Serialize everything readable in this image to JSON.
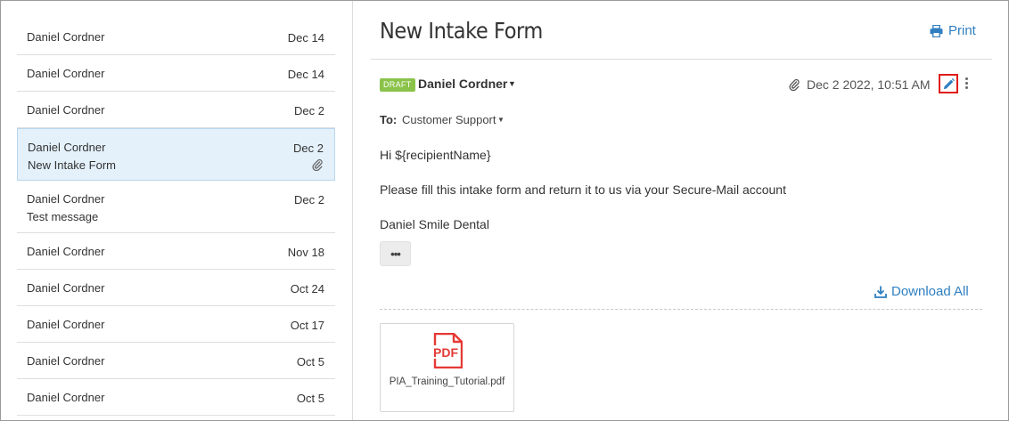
{
  "messages": [
    {
      "sender": "Daniel Cordner",
      "date": "Dec 14",
      "subject": ""
    },
    {
      "sender": "Daniel Cordner",
      "date": "Dec 14",
      "subject": ""
    },
    {
      "sender": "Daniel Cordner",
      "date": "Dec 2",
      "subject": ""
    },
    {
      "sender": "Daniel Cordner",
      "date": "Dec 2",
      "subject": "New Intake Form",
      "has_attachment": true,
      "selected": true
    },
    {
      "sender": "Daniel Cordner",
      "date": "Dec 2",
      "subject": "Test message"
    },
    {
      "sender": "Daniel Cordner",
      "date": "Nov 18",
      "subject": ""
    },
    {
      "sender": "Daniel Cordner",
      "date": "Oct 24",
      "subject": ""
    },
    {
      "sender": "Daniel Cordner",
      "date": "Oct 17",
      "subject": ""
    },
    {
      "sender": "Daniel Cordner",
      "date": "Oct 5",
      "subject": ""
    },
    {
      "sender": "Daniel Cordner",
      "date": "Oct 5",
      "subject": ""
    }
  ],
  "reader": {
    "title": "New Intake Form",
    "print_label": "Print",
    "draft_badge": "DRAFT",
    "from_name": "Daniel Cordner",
    "timestamp": "Dec 2 2022, 10:51 AM",
    "to_label": "To:",
    "to_value": "Customer Support",
    "body": [
      "Hi ${recipientName}",
      "Please fill this intake form and return it to us via your Secure-Mail account",
      "Daniel Smile Dental"
    ],
    "ellipsis_label": "•••",
    "download_all_label": "Download All",
    "attachment": {
      "icon_text": "PDF",
      "filename": "PIA_Training_Tutorial.pdf"
    }
  },
  "icons": {
    "print": "printer-icon",
    "attachment": "paperclip-icon",
    "edit": "pencil-icon",
    "more": "kebab-icon",
    "download": "download-icon",
    "file": "pdf-file-icon"
  },
  "colors": {
    "accent": "#2f7fc1",
    "draft_badge": "#8bc34a",
    "selected_row": "#e4f1fb",
    "edit_highlight": "#e01b1b",
    "pdf_red": "#e53935"
  }
}
